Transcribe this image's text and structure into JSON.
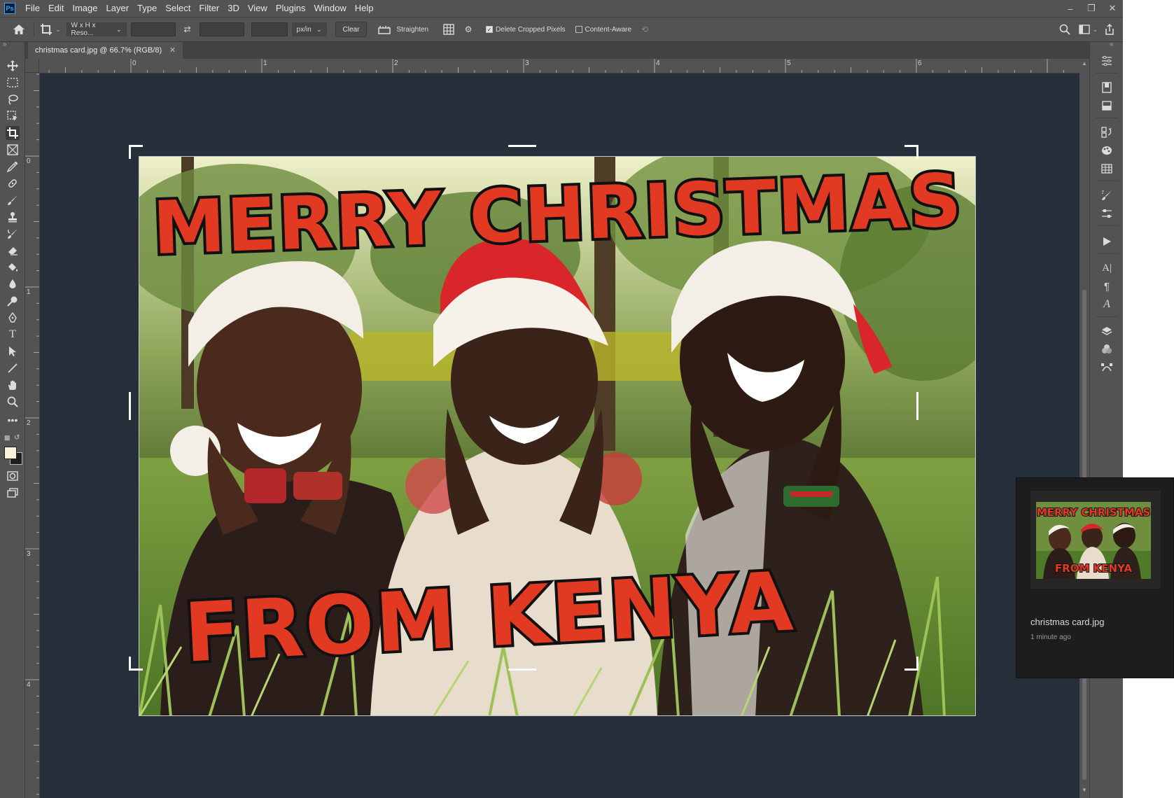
{
  "app": {
    "logo": "Ps"
  },
  "menu": [
    "File",
    "Edit",
    "Image",
    "Layer",
    "Type",
    "Select",
    "Filter",
    "3D",
    "View",
    "Plugins",
    "Window",
    "Help"
  ],
  "options": {
    "ratio_dropdown": "W x H x Reso...",
    "unit_dropdown": "px/in",
    "clear_label": "Clear",
    "straighten_label": "Straighten",
    "delete_cropped_label": "Delete Cropped Pixels",
    "delete_cropped_checked": true,
    "content_aware_label": "Content-Aware",
    "content_aware_checked": false
  },
  "document": {
    "tab_title": "christmas card.jpg @ 66.7% (RGB/8)"
  },
  "rulers": {
    "horizontal": [
      "0",
      "1",
      "2",
      "3",
      "4",
      "5",
      "6"
    ],
    "vertical": [
      "0",
      "1",
      "2",
      "3",
      "4"
    ]
  },
  "colors": {
    "foreground": "#f7f3d7",
    "background": "#1e1e1e",
    "canvas_bg": "#25303a",
    "ui": "#535353"
  },
  "card": {
    "headline_top": "MERRY CHRISTMAS",
    "headline_bottom": "FROM KENYA"
  },
  "recent_popup": {
    "filename": "christmas card.jpg",
    "time": "1 minute ago"
  },
  "icons": {
    "tools": [
      "move-icon",
      "marquee-icon",
      "lasso-icon",
      "object-select-icon",
      "crop-icon",
      "frame-icon",
      "eyedropper-icon",
      "healing-icon",
      "brush-icon",
      "stamp-icon",
      "history-brush-icon",
      "eraser-icon",
      "bucket-icon",
      "blur-icon",
      "dodge-icon",
      "pen-icon",
      "type-icon",
      "path-select-icon",
      "line-icon",
      "hand-icon",
      "zoom-icon",
      "more-icon"
    ],
    "panels": [
      "properties-icon",
      "libraries-icon",
      "adjustments-icon",
      "history-icon",
      "color-icon",
      "swatches-icon",
      "brushes-icon",
      "brush-settings-icon",
      "actions-icon",
      "character-icon",
      "paragraph-icon",
      "glyphs-icon",
      "layers-icon",
      "channels-icon",
      "paths-icon"
    ]
  }
}
